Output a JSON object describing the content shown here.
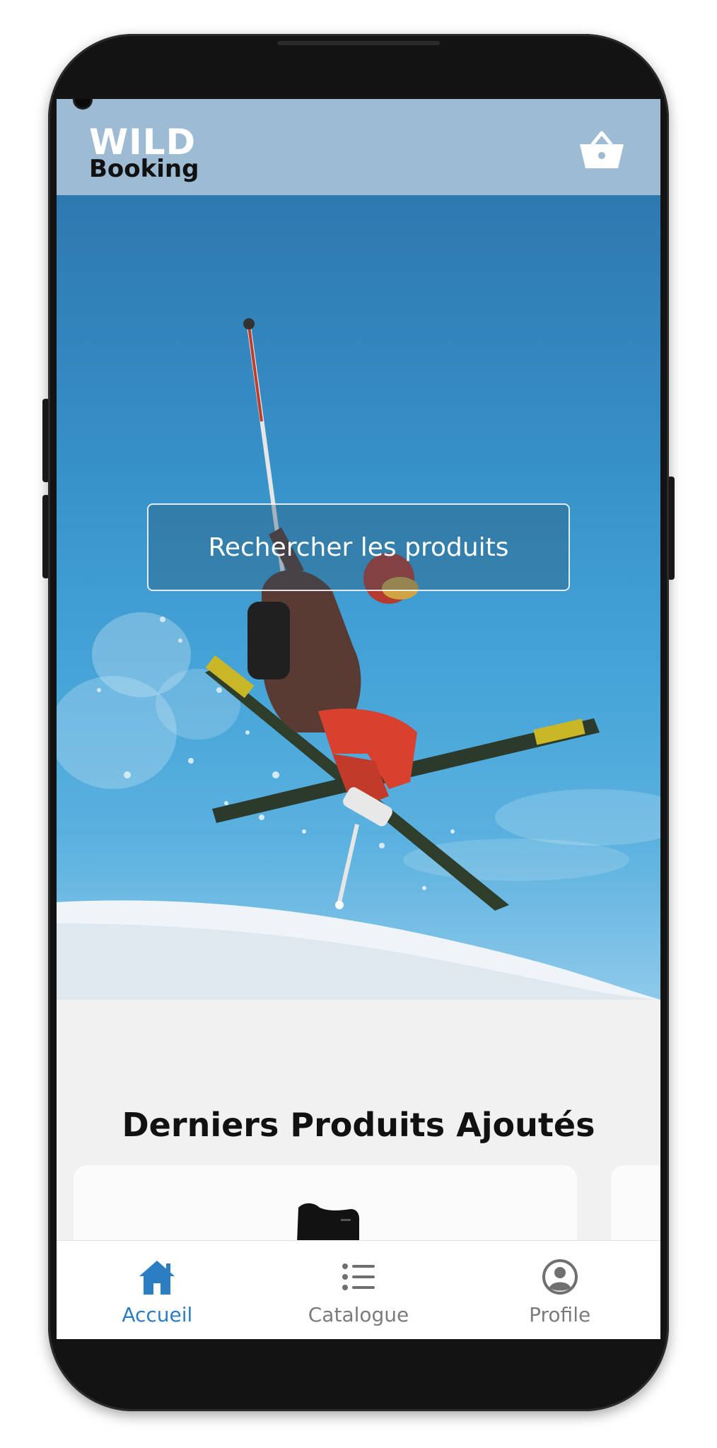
{
  "header": {
    "logo_line1": "WILD",
    "logo_line2": "Booking",
    "background_color": "#9dbbd3",
    "cart_icon": "basket-icon"
  },
  "hero": {
    "search_placeholder": "Rechercher les produits",
    "image_subject": "skier-jump-photo"
  },
  "content": {
    "section_title": "Derniers Produits Ajoutés"
  },
  "bottom_nav": {
    "accent_color": "#2b7ec1",
    "items": [
      {
        "label": "Accueil",
        "icon": "home-icon",
        "active": true
      },
      {
        "label": "Catalogue",
        "icon": "list-icon",
        "active": false
      },
      {
        "label": "Profile",
        "icon": "user-circle-icon",
        "active": false
      }
    ]
  }
}
